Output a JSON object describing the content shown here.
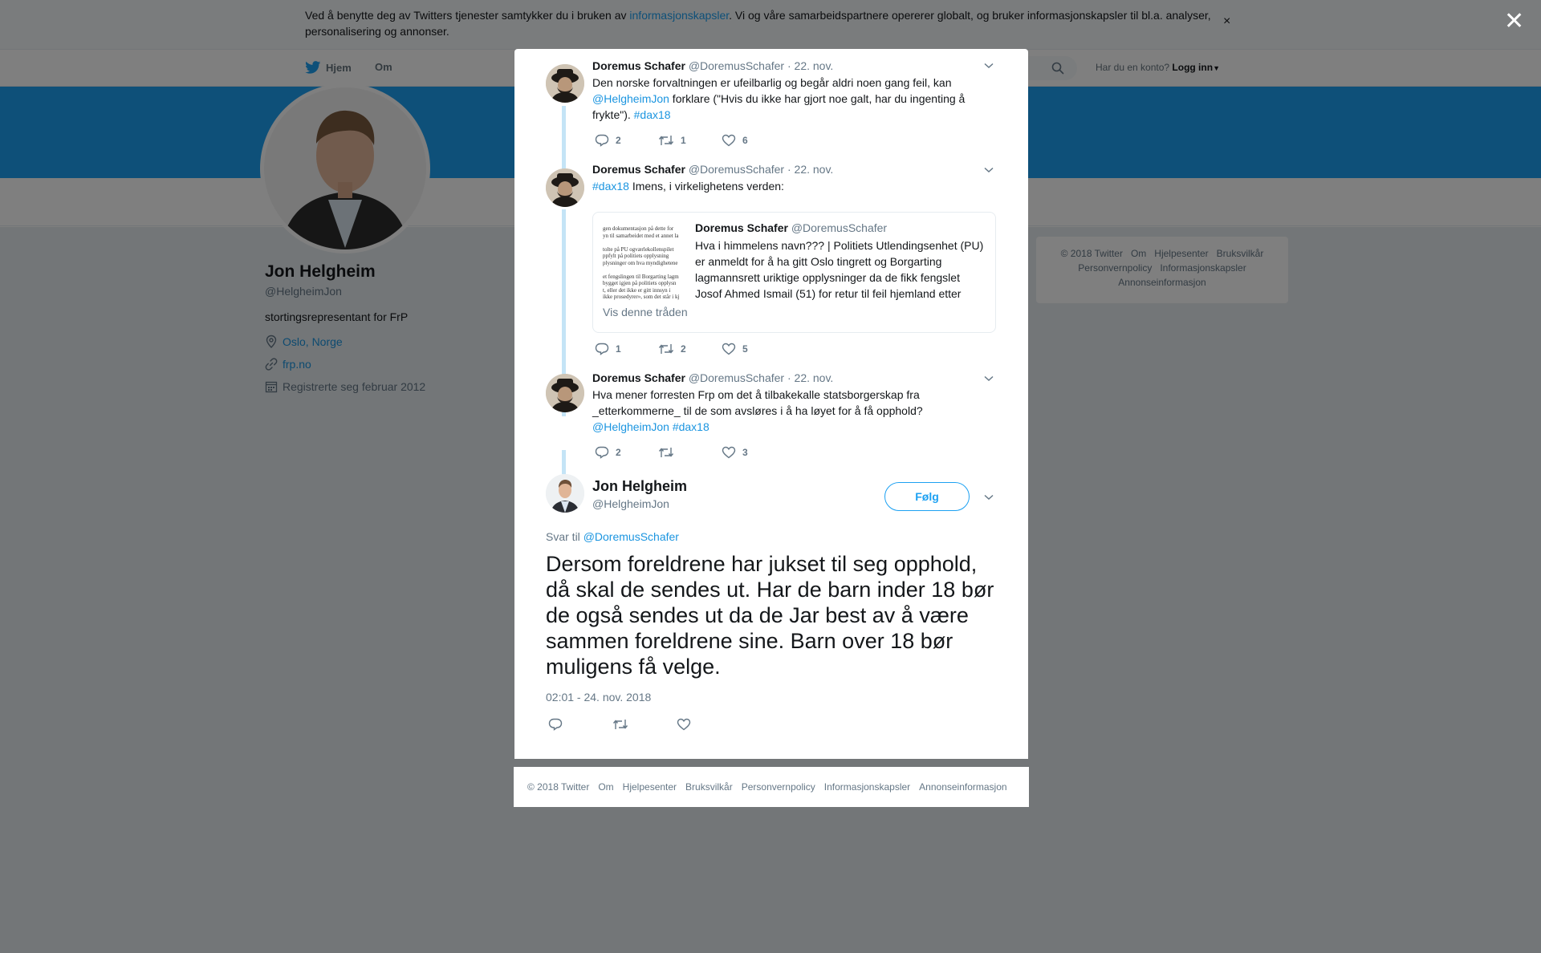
{
  "cookie_bar": {
    "text_before": "Ved å benytte deg av Twitters tjenester samtykker du i bruken av ",
    "link": "informasjonskapsler",
    "text_after": ". Vi og våre samarbeidspartnere opererer globalt, og bruker informasjonskapsler til bl.a. analyser, personalisering og annonser.",
    "close": "×"
  },
  "nav": {
    "home": "Hjem",
    "about": "Om",
    "account_question": "Har du en konto?",
    "login": "Logg inn"
  },
  "profile": {
    "name": "Jon Helgheim",
    "handle": "@HelgheimJon",
    "bio": "stortingsrepresentant for FrP",
    "location": "Oslo, Norge",
    "website": "frp.no",
    "joined": "Registrerte seg februar 2012"
  },
  "side_footer": {
    "line1": [
      "© 2018 Twitter",
      "Om",
      "Hjelpesenter",
      "Bruksvilkår"
    ],
    "line2": [
      "Personvernpolicy",
      "Informasjonskapsler"
    ],
    "line3": [
      "Annonseinformasjon"
    ]
  },
  "overlay_close": "✕",
  "tweets": [
    {
      "name": "Doremus Schafer",
      "handle": "@DoremusSchafer",
      "date": "· 22. nov.",
      "text_1": "Den norske forvaltningen er ufeilbarlig og begår aldri noen gang feil, kan ",
      "mention": "@HelgheimJon",
      "text_2": " forklare (\"Hvis du ikke har gjort noe galt, har du ingenting å frykte\"). ",
      "hashtag": "#dax18",
      "replies": "2",
      "retweets": "1",
      "likes": "6"
    },
    {
      "name": "Doremus Schafer",
      "handle": "@DoremusSchafer",
      "date": "· 22. nov.",
      "hashtag": "#dax18",
      "text": " Imens, i virkelighetens verden:",
      "replies": "1",
      "retweets": "2",
      "likes": "5",
      "quote": {
        "name": "Doremus Schafer",
        "handle": "@DoremusSchafer",
        "text": "Hva i himmelens navn??? | Politiets Utlendingsenhet (PU) er anmeldt for å ha gitt Oslo tingrett og Borgarting lagmannsrett uriktige opplysninger da de fikk fengslet Josof Ahmed Ismail (51) for retur til feil hjemland etter",
        "link": "Vis denne tråden",
        "image_lines": [
          "gen dokumentasjon på dette for",
          "yn til samarbeidet med et annet la",
          "",
          "tolte på PU ogværlekollenspilet",
          "ppfylt på politiets opplysning",
          "plysninger om hva myndighetene",
          "",
          "et fengslingen til Borgarting lagm",
          "bygget igjen på politiets opplysn",
          "t, eller det ikke er gitt innsyn i",
          "ikke prosedyrer», som det står i kj"
        ]
      }
    },
    {
      "name": "Doremus Schafer",
      "handle": "@DoremusSchafer",
      "date": "· 22. nov.",
      "text_1": "Hva mener forresten Frp om det å tilbakekalle statsborgerskap fra _etterkommerne_ til de som avsløres i å ha løyet for å få opphold?",
      "mention": "@HelgheimJon",
      "hashtag": "#dax18",
      "replies": "2",
      "retweets": "",
      "likes": "3"
    }
  ],
  "main_tweet": {
    "name": "Jon Helgheim",
    "handle": "@HelgheimJon",
    "follow": "Følg",
    "reply_to_label": "Svar til ",
    "reply_to": "@DoremusSchafer",
    "text": "Dersom foreldrene har jukset til seg opphold, då skal de sendes ut. Har de barn inder 18 bør de også sendes ut da de Jar best av å være sammen foreldrene sine. Barn over 18 bør muligens få velge.",
    "timestamp": "02:01 - 24. nov. 2018"
  },
  "modal_footer": [
    "© 2018 Twitter",
    "Om",
    "Hjelpesenter",
    "Bruksvilkår",
    "Personvernpolicy",
    "Informasjonskapsler",
    "Annonseinformasjon"
  ],
  "colors": {
    "brand_blue": "#1da1f2",
    "link_blue": "#1b95e0",
    "muted_text": "#657786",
    "thread_line": "#c4e4f6",
    "overlay": "rgba(0,0,0,0.5)"
  },
  "icons": [
    "twitter-bird-icon",
    "home-icon",
    "search-icon",
    "caret-down-icon",
    "location-icon",
    "link-icon",
    "calendar-icon",
    "reply-icon",
    "retweet-icon",
    "like-icon",
    "chevron-down-icon",
    "close-icon"
  ]
}
